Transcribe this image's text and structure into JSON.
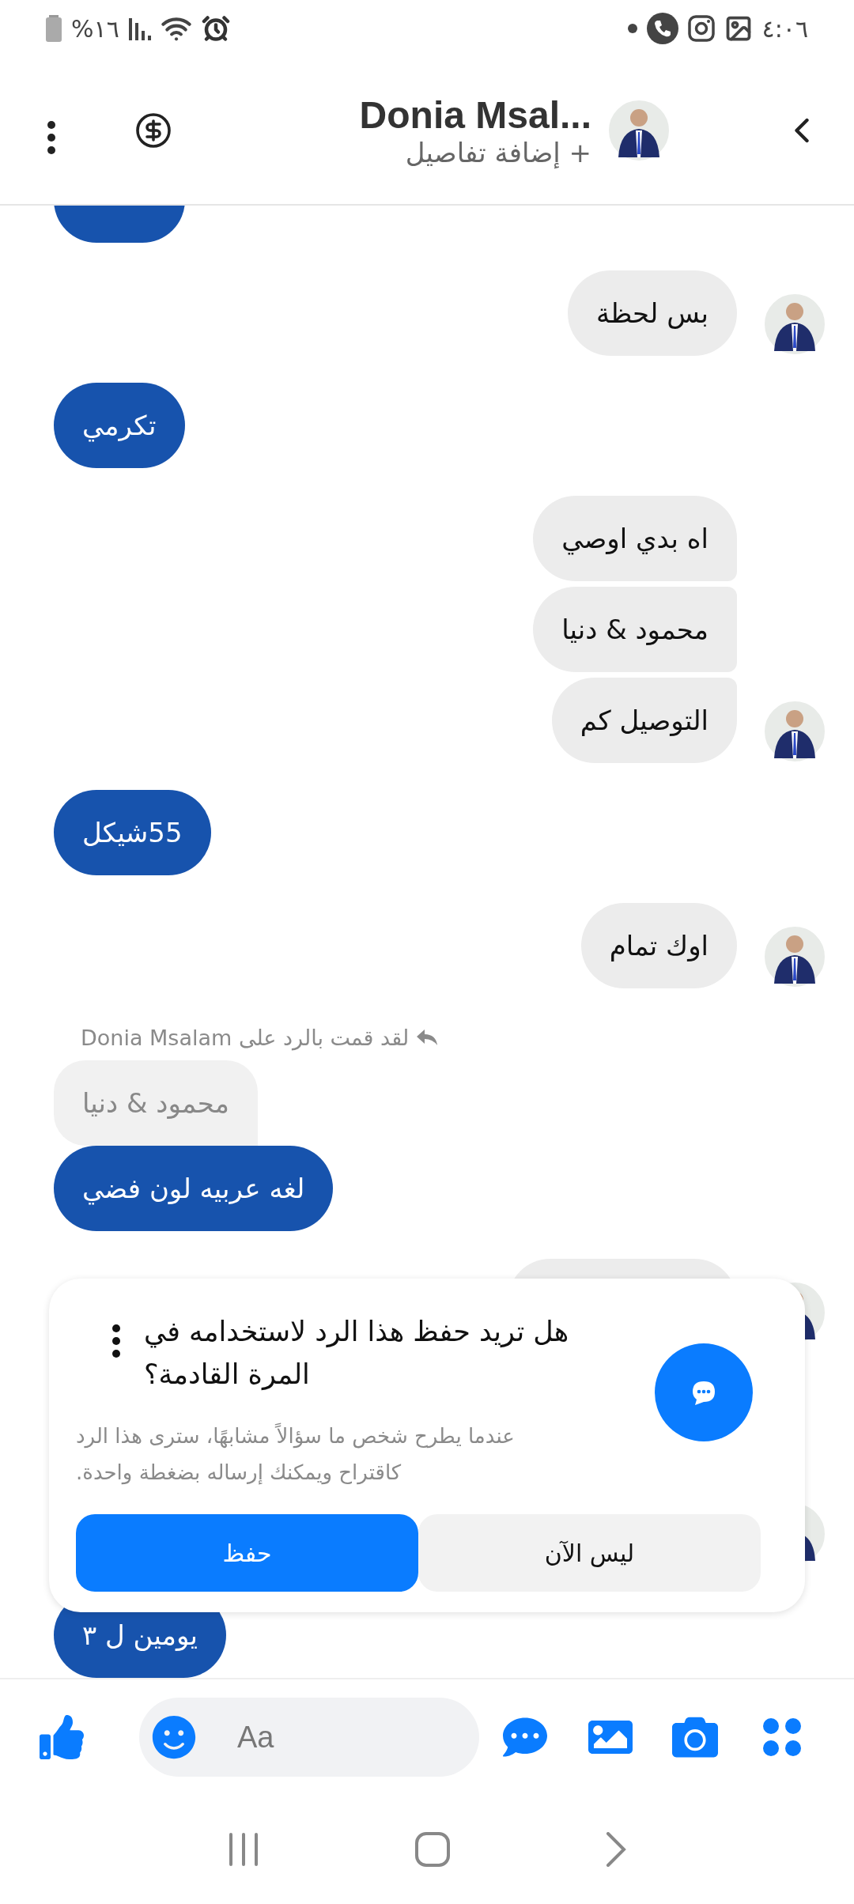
{
  "status_bar": {
    "battery": "%١٦",
    "time": "٤:٠٦"
  },
  "header": {
    "name": "Donia Msal...",
    "subtitle": "+ إضافة تفاصيل"
  },
  "messages": [
    {
      "kind": "sent_cut"
    },
    {
      "kind": "received",
      "text": "بس لحظة",
      "joined_above": false,
      "joined_below": false,
      "avatar": true
    },
    {
      "kind": "sent",
      "text": "تكرمي"
    },
    {
      "kind": "received",
      "text": "اه بدي اوصي",
      "joined_above": false,
      "joined_below": true,
      "avatar": false
    },
    {
      "kind": "received",
      "text": "محمود & دنيا",
      "joined_above": true,
      "joined_below": true,
      "avatar": false
    },
    {
      "kind": "received",
      "text": "التوصيل كم",
      "joined_above": true,
      "joined_below": false,
      "avatar": true
    },
    {
      "kind": "sent",
      "text": "55شيكل"
    },
    {
      "kind": "received",
      "text": "اوك تمام",
      "joined_above": false,
      "joined_below": false,
      "avatar": true
    },
    {
      "kind": "reply_label",
      "text": "لقد قمت بالرد على Donia Msalam"
    },
    {
      "kind": "quoted",
      "text": "محمود & دنيا"
    },
    {
      "kind": "sent",
      "text": "لغه عربيه لون فضي"
    },
    {
      "kind": "received",
      "avatar": true,
      "joined_above": false,
      "joined_below": false
    },
    {
      "kind": "avatar_only"
    },
    {
      "kind": "sent",
      "text": "يومين ل ٣"
    }
  ],
  "save_reply_card": {
    "title": "هل تريد حفظ هذا الرد لاستخدامه في المرة القادمة؟",
    "body": "عندما يطرح شخص ما سؤالاً مشابهًا، سترى هذا الرد كاقتراح ويمكنك إرساله بضغطة واحدة.",
    "buttons": [
      {
        "label": "ليس الآن",
        "kind": "secondary"
      },
      {
        "label": "حفظ",
        "kind": "primary"
      }
    ]
  },
  "composer": {
    "placeholder": "Aa"
  }
}
